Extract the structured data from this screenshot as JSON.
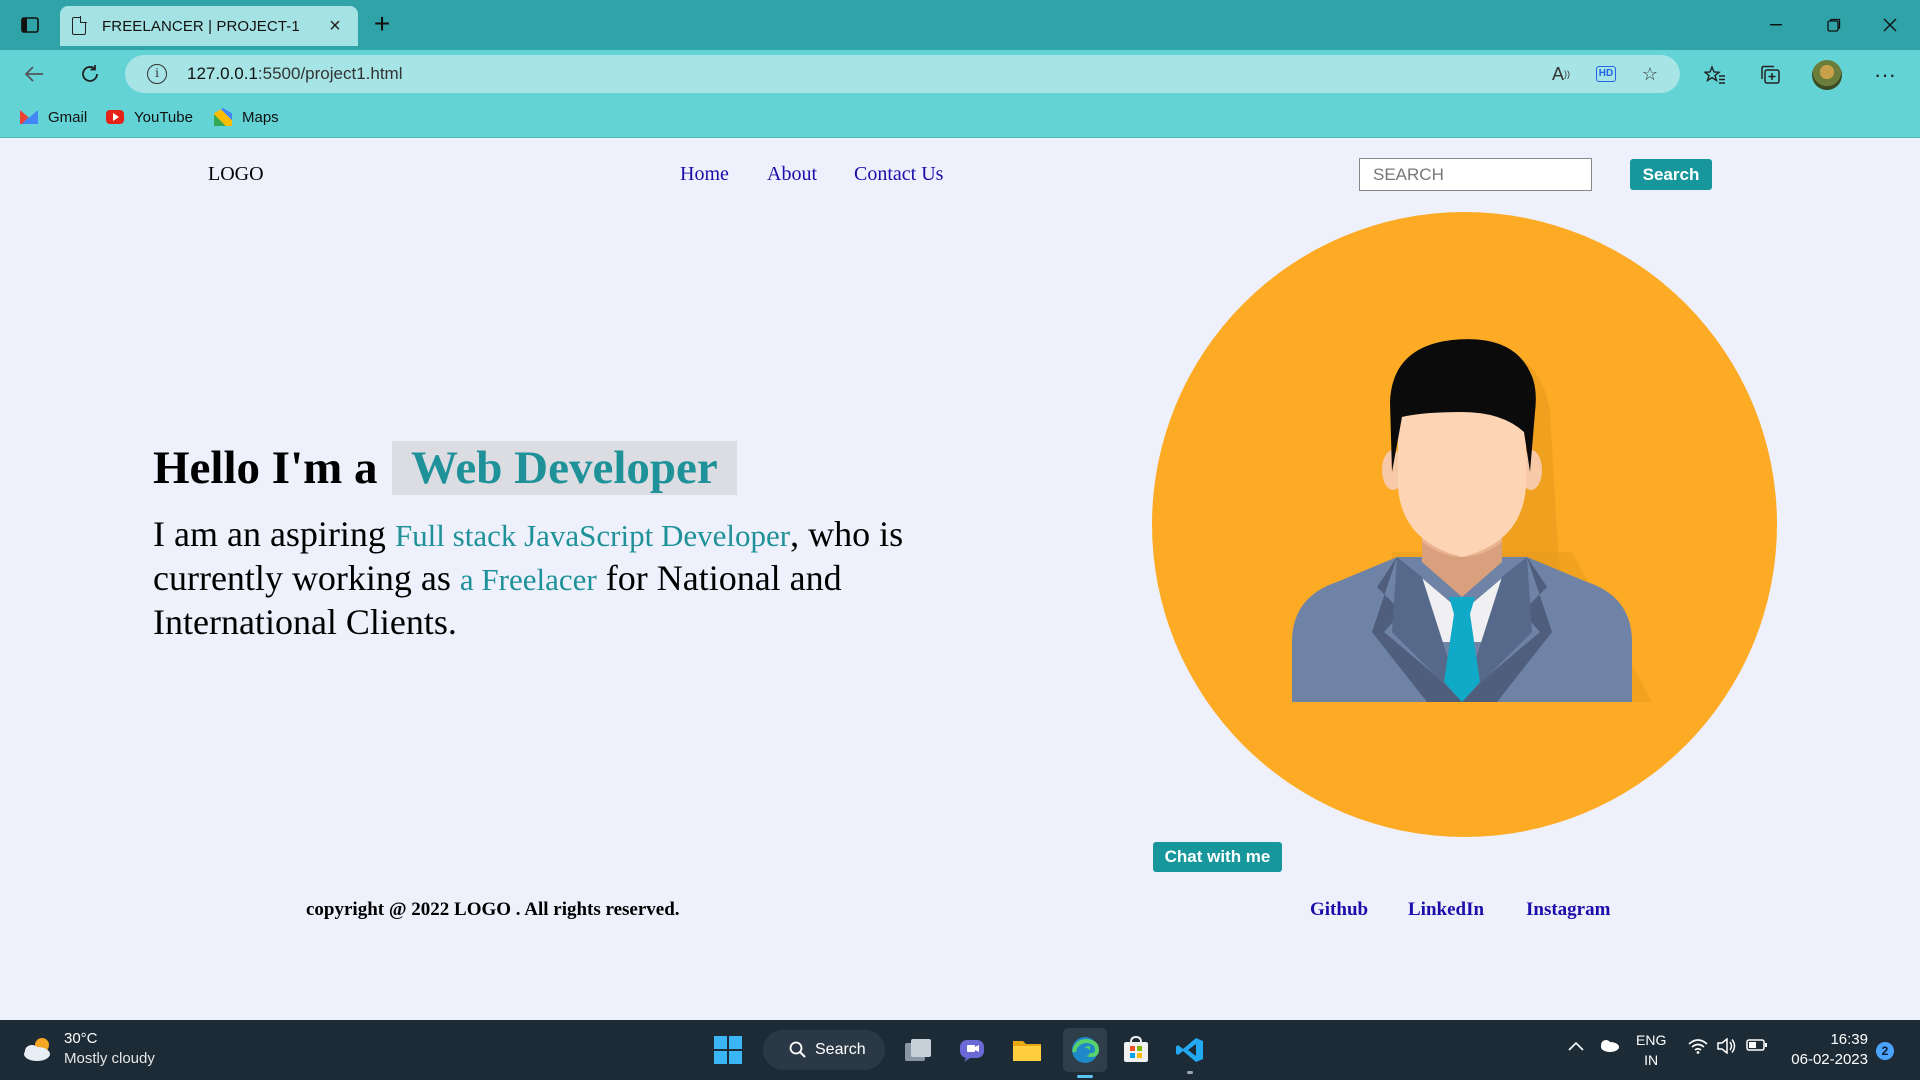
{
  "browser": {
    "tab_title": "FREELANCER | PROJECT-1",
    "address": {
      "host": "127.0.0.1",
      "path": ":5500/project1.html"
    },
    "bookmarks": [
      {
        "label": "Gmail",
        "icon": "gmail-icon"
      },
      {
        "label": "YouTube",
        "icon": "youtube-icon"
      },
      {
        "label": "Maps",
        "icon": "maps-icon"
      }
    ]
  },
  "site": {
    "logo": "LOGO",
    "nav": [
      "Home",
      "About",
      "Contact Us"
    ],
    "search": {
      "placeholder": "SEARCH",
      "button": "Search"
    },
    "hero": {
      "title_prefix": "Hello I'm a",
      "title_highlight": "Web Developer",
      "text_1": "I am an aspiring ",
      "accent_1": "Full stack JavaScript Developer",
      "text_2": ", who is currently working as ",
      "accent_2": "a Freelacer",
      "text_3": " for National and International Clients."
    },
    "chat_button": "Chat with me",
    "copyright": "copyright @ 2022 LOGO . All rights reserved.",
    "social": [
      "Github",
      "LinkedIn",
      "Instagram"
    ],
    "colors": {
      "accent": "#1f9199",
      "avatar_bg": "#fdab25",
      "button": "#17979b"
    }
  },
  "taskbar": {
    "weather_temp": "30°C",
    "weather_desc": "Mostly cloudy",
    "search_label": "Search",
    "lang_1": "ENG",
    "lang_2": "IN",
    "time": "16:39",
    "date": "06-02-2023",
    "notifications": "2"
  }
}
